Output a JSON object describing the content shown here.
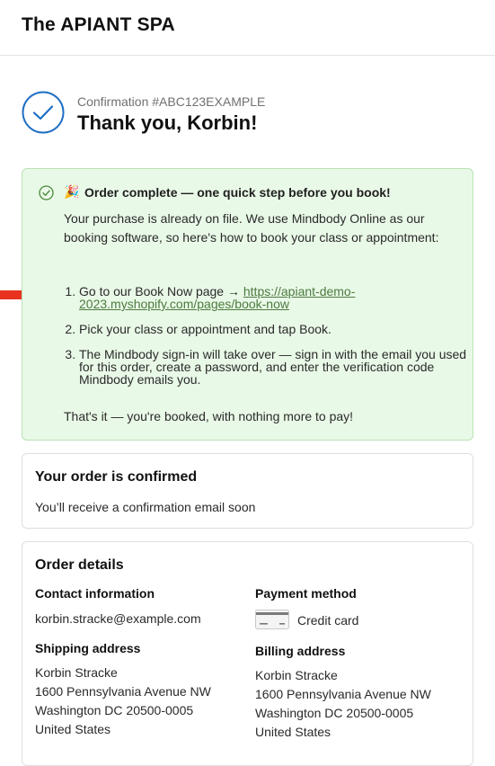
{
  "header": {
    "store_name": "The APIANT SPA"
  },
  "confirmation": {
    "number_label": "Confirmation #ABC123EXAMPLE",
    "thank_you": "Thank you, Korbin!"
  },
  "notice": {
    "emoji": "🎉",
    "title": "Order complete — one quick step before you book!",
    "intro": "Your purchase is already on file. We use Mindbody Online as our booking software, so here's how to book your class or appointment:",
    "steps": [
      {
        "prefix": "Go to our Book Now page → ",
        "link": "https://apiant-demo-2023.myshopify.com/pages/book-now"
      },
      {
        "text": "Pick your class or appointment and tap Book."
      },
      {
        "text": "The Mindbody sign-in will take over — sign in with the email you used for this order, create a password, and enter the verification code Mindbody emails you."
      }
    ],
    "outro": "That's it — you're booked, with nothing more to pay!"
  },
  "order_status": {
    "title": "Your order is confirmed",
    "message": "You’ll receive a confirmation email soon"
  },
  "order_details": {
    "title": "Order details",
    "contact_heading": "Contact information",
    "contact_email": "korbin.stracke@example.com",
    "payment_heading": "Payment method",
    "payment_method": "Credit card",
    "shipping_heading": "Shipping address",
    "shipping": [
      "Korbin Stracke",
      "1600 Pennsylvania Avenue NW",
      "Washington DC 20500-0005",
      "United States"
    ],
    "billing_heading": "Billing address",
    "billing": [
      "Korbin Stracke",
      "1600 Pennsylvania Avenue NW",
      "Washington DC 20500-0005",
      "United States"
    ]
  },
  "colors": {
    "accent_blue": "#1f6fc4",
    "success_bg": "#e9f9e7",
    "success_border": "#b9e3b4",
    "link_green": "#4c7a3f",
    "arrow_red": "#e8321f"
  }
}
